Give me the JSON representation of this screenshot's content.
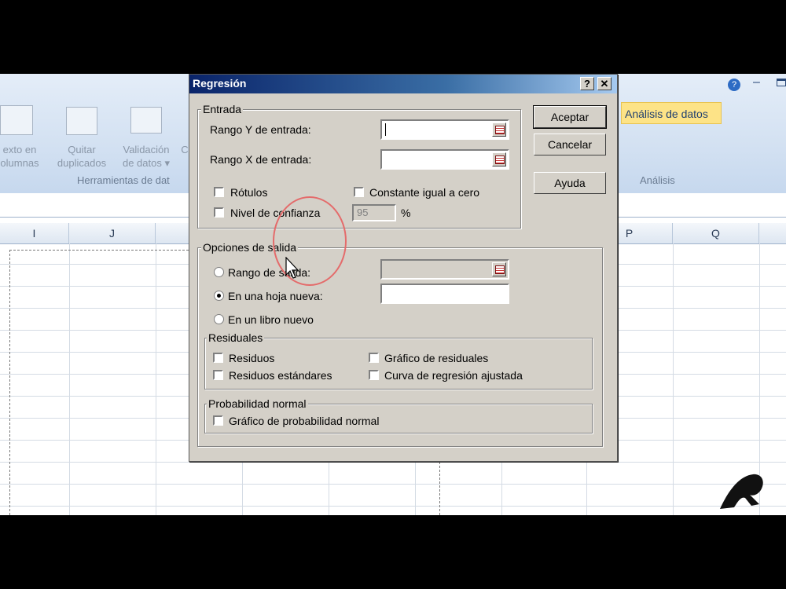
{
  "ribbon": {
    "texto_columnas": [
      "exto en",
      "olumnas"
    ],
    "quitar_duplicados": [
      "Quitar",
      "duplicados"
    ],
    "validacion_datos": [
      "Validación",
      "de datos ▾"
    ],
    "truncated_c": "C",
    "group_herramientas": "Herramientas de dat",
    "analisis_datos_button": "Análisis de datos",
    "group_analisis": "Análisis"
  },
  "columns": [
    "I",
    "J",
    "P",
    "Q"
  ],
  "window_controls": {
    "help": "?",
    "minimize": "–"
  },
  "dialog": {
    "title": "Regresión",
    "help_button": "?",
    "close_button": "✕",
    "entrada": {
      "legend": "Entrada",
      "rango_y_label": "Rango Y de entrada:",
      "rango_y_value": "",
      "rango_x_label": "Rango X de entrada:",
      "rango_x_value": "",
      "rotulos_label": "Rótulos",
      "rotulos_checked": false,
      "constante_label": "Constante igual a cero",
      "constante_checked": false,
      "nivel_label": "Nivel de confianza",
      "nivel_checked": false,
      "nivel_value": "95",
      "nivel_unit": "%"
    },
    "buttons": {
      "aceptar": "Aceptar",
      "cancelar": "Cancelar",
      "ayuda": "Ayuda"
    },
    "salida": {
      "legend": "Opciones de salida",
      "rango_salida_label": "Rango de salida:",
      "hoja_nueva_label": "En una hoja nueva:",
      "libro_nuevo_label": "En un libro nuevo",
      "selected_option": "En una hoja nueva:"
    },
    "residuales": {
      "legend": "Residuales",
      "residuos": "Residuos",
      "residuos_estandares": "Residuos estándares",
      "grafico_residuales": "Gráfico de residuales",
      "curva_regresion": "Curva de regresión ajustada"
    },
    "probabilidad": {
      "legend": "Probabilidad normal",
      "grafico_probabilidad": "Gráfico de probabilidad normal"
    }
  },
  "colors": {
    "title_bar_start": "#0a246a",
    "title_bar_end": "#a6caf0",
    "dialog_face": "#d4d0c8",
    "highlight_button": "#fde387",
    "cursor_circle": "#e46b6b"
  }
}
